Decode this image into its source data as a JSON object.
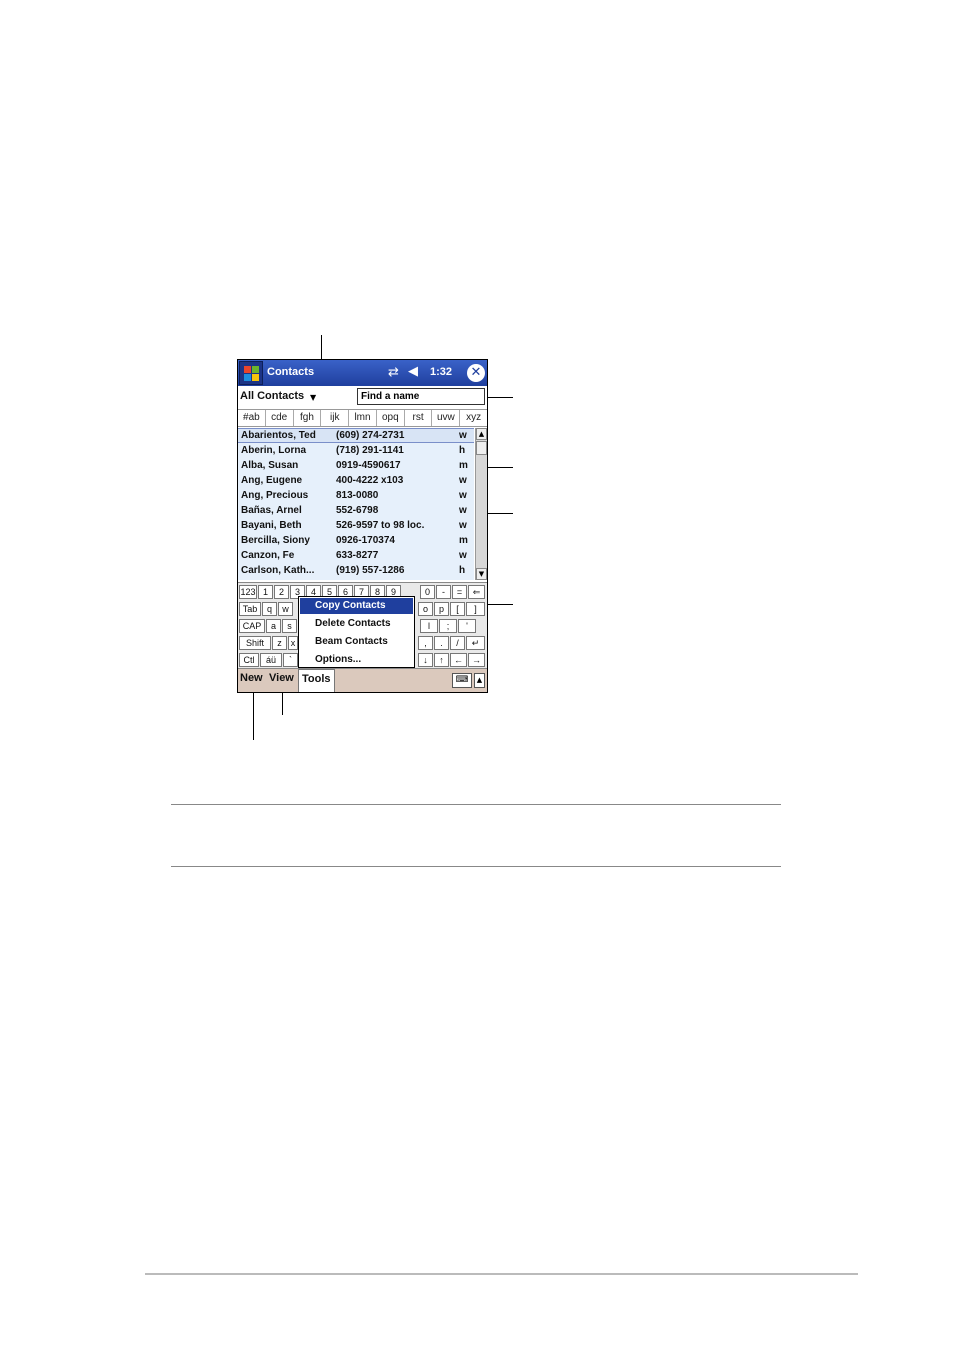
{
  "titlebar": {
    "app_title": "Contacts",
    "time": "1:32",
    "sync_icon": "sync-arrows-icon",
    "speaker_icon": "speaker-icon",
    "close_icon": "close-icon"
  },
  "category": {
    "label": "All Contacts",
    "find_placeholder": "Find a name"
  },
  "abc_tabs": [
    "#ab",
    "cde",
    "fgh",
    "ijk",
    "lmn",
    "opq",
    "rst",
    "uvw",
    "xyz"
  ],
  "contacts": [
    {
      "name": "Abarientos, Ted",
      "phone": "(609) 274-2731",
      "type": "w"
    },
    {
      "name": "Aberin, Lorna",
      "phone": "(718) 291-1141",
      "type": "h"
    },
    {
      "name": "Alba, Susan",
      "phone": "0919-4590617",
      "type": "m"
    },
    {
      "name": "Ang, Eugene",
      "phone": "400-4222 x103",
      "type": "w"
    },
    {
      "name": "Ang, Precious",
      "phone": "813-0080",
      "type": "w"
    },
    {
      "name": "Bañas, Arnel",
      "phone": "552-6798",
      "type": "w"
    },
    {
      "name": "Bayani, Beth",
      "phone": "526-9597 to 98  loc.",
      "type": "w"
    },
    {
      "name": "Bercilla, Siony",
      "phone": "0926-170374",
      "type": "m"
    },
    {
      "name": "Canzon, Fe",
      "phone": "633-8277",
      "type": "w"
    },
    {
      "name": "Carlson, Kath...",
      "phone": "(919) 557-1286",
      "type": "h"
    }
  ],
  "keyboard": {
    "row1": [
      "123",
      "1",
      "2",
      "3",
      "4",
      "5",
      "6",
      "7",
      "8",
      "9",
      "0",
      "-",
      "=",
      "⇐"
    ],
    "row2_left": [
      "Tab",
      "q",
      "w"
    ],
    "row2_right": [
      "o",
      "p",
      "[",
      "]"
    ],
    "row3_left": [
      "CAP",
      "a",
      "s"
    ],
    "row3_right": [
      "l",
      ";",
      "'"
    ],
    "row4_left": [
      "Shift",
      "z",
      "x"
    ],
    "row4_right": [
      ",",
      ".",
      "/",
      "↵"
    ],
    "row5_left": [
      "Ctl",
      "áü",
      "`"
    ],
    "row5_right": [
      "↓",
      "↑",
      "←",
      "→"
    ]
  },
  "tools_menu": [
    "Copy Contacts",
    "Delete Contacts",
    "Beam Contacts",
    "Options..."
  ],
  "menubar": {
    "new": "New",
    "view": "View",
    "tools": "Tools",
    "keyboard_icon": "keyboard-icon"
  }
}
